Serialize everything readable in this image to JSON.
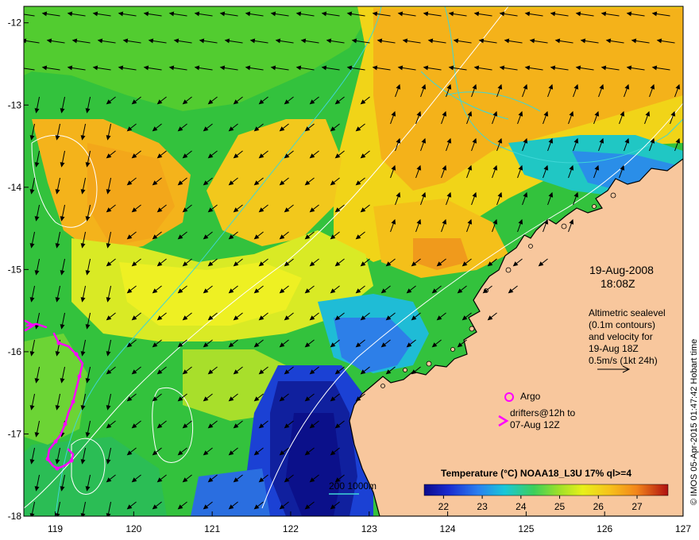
{
  "map": {
    "lon_range": [
      118.6,
      127
    ],
    "lat_range": [
      -18,
      -11.8
    ],
    "lon_ticks": [
      "119",
      "120",
      "121",
      "122",
      "123",
      "124",
      "125",
      "126",
      "127"
    ],
    "lat_ticks": [
      "-12",
      "-13",
      "-14",
      "-15",
      "-16",
      "-17",
      "-18"
    ],
    "colors": {
      "land": "#f8c79d",
      "coast": "#000000",
      "contour": "#ffffff",
      "bathy": "#3fd6d6",
      "drifter": "#ff00ff"
    }
  },
  "date_line1": "19-Aug-2008",
  "date_line2": "18:08Z",
  "altimetry": {
    "line1": "Altimetric sealevel",
    "line2": "(0.1m contours)",
    "line3": "and velocity for",
    "line4": "19-Aug 18Z",
    "line5": "0.5m/s (1kt 24h)"
  },
  "legend": {
    "argo": "Argo",
    "drifters_line1": "drifters@12h to",
    "drifters_line2": "07-Aug 12Z",
    "bathy": "200  1000m"
  },
  "colorbar": {
    "title": "Temperature (°C) NOAA18_L3U 17% ql>=4",
    "range": [
      21.5,
      27.8
    ],
    "ticks": [
      "22",
      "23",
      "24",
      "25",
      "26",
      "27"
    ]
  },
  "credit": "© IMOS 05-Apr-2015 01:47:42 Hobart time"
}
